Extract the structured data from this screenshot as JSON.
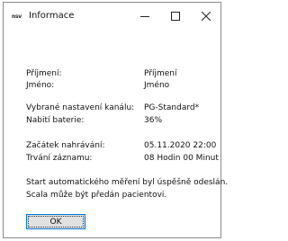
{
  "window": {
    "icon_text": "nsv",
    "title": "Informace"
  },
  "titlebar_buttons": {
    "minimize": "minimize-icon",
    "maximize": "maximize-icon",
    "close": "close-icon"
  },
  "fields": [
    {
      "label": "Příjmení:",
      "value": "Příjmení"
    },
    {
      "label": "Jméno:",
      "value": "Jméno"
    },
    {
      "label": "Vybrané nastavení kanálu:",
      "value": "PG-Standard*"
    },
    {
      "label": "Nabití baterie:",
      "value": "36%"
    },
    {
      "label": "Začátek nahrávání:",
      "value": "05.11.2020 22:00"
    },
    {
      "label": "Trvání záznamu:",
      "value": "08 Hodin 00 Minut"
    }
  ],
  "message": {
    "line1": "Start automatického měření byl úspěšně odeslán.",
    "line2": "Scala může být předán pacientovi."
  },
  "buttons": {
    "ok": "OK"
  }
}
